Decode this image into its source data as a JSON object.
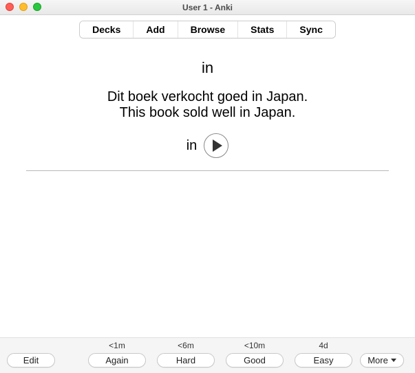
{
  "window": {
    "title": "User 1 - Anki"
  },
  "toolbar": {
    "decks": "Decks",
    "add": "Add",
    "browse": "Browse",
    "stats": "Stats",
    "sync": "Sync"
  },
  "card": {
    "front": "in",
    "sentence_nl": "Dit boek verkocht goed in Japan.",
    "sentence_en": "This book sold well in Japan.",
    "audio_label": "in"
  },
  "answer": {
    "intervals": {
      "again": "<1m",
      "hard": "<6m",
      "good": "<10m",
      "easy": "4d"
    },
    "buttons": {
      "edit": "Edit",
      "again": "Again",
      "hard": "Hard",
      "good": "Good",
      "easy": "Easy",
      "more": "More"
    }
  }
}
